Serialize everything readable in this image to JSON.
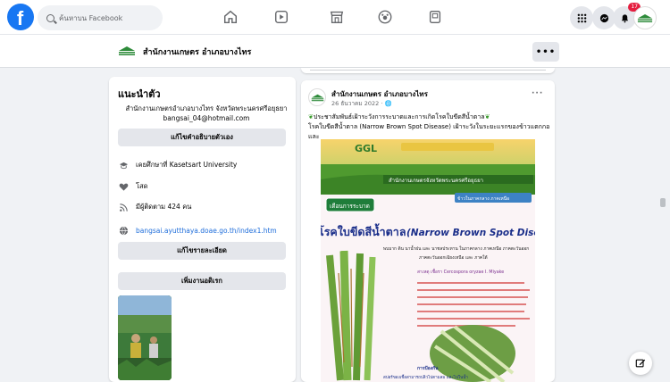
{
  "topbar": {
    "logo_letter": "f",
    "search_placeholder": "ค้นหาบน Facebook",
    "notification_count": "17"
  },
  "page": {
    "name": "สำนักงานเกษตร อำเภอบางไทร",
    "more_label": "•••"
  },
  "intro": {
    "title": "แนะนำตัว",
    "bio_line1": "สำนักงานเกษตรอำเภอบางไทร จังหวัดพระนครศรีอยุธยา",
    "bio_line2": "bangsai_04@hotmail.com",
    "edit_bio_label": "แก้ไขคำอธิบายตัวเอง",
    "studied": "เคยศึกษาที่ Kasetsart University",
    "relationship": "โสด",
    "followers": "มีผู้ติดตาม 424 คน",
    "website": "bangsai.ayutthaya.doae.go.th/index1.htm",
    "edit_details_label": "แก้ไขรายละเอียด",
    "add_hobbies_label": "เพิ่มงานอดิเรก"
  },
  "post": {
    "author": "สำนักงานเกษตร อำเภอบางไทร",
    "date": "26 ธันวาคม 2022 · ",
    "menu": "···",
    "text_line1": "ประชาสัมพันธ์เฝ้าระวังการระบาดและการเกิดโรคใบขีดสีน้ำตาล",
    "text_line2": "โรคใบขีดสีน้ำตาล (Narrow Brown Spot Disease) เฝ้าระวังในระยะแรกของข้าวแตกกอและ",
    "image": {
      "header_text": "สำนักงานเกษตรจังหวัดพระนครศรีอยุธยา",
      "tag_left": "เตือนการระบาด",
      "tag_right": "ข้าวในภาคกลาง ภาคเหนือ",
      "title_th": "โรคใบขีดสีน้ำตาล",
      "title_en": "(Narrow Brown Spot Disease)",
      "subtitle1": "พบมาก ดิน นาน้ำฝน และ นาชลประทาน ในภาคกลาง ภาคเหนือ ภาคตะวันออก",
      "subtitle2": "ภาคตะวันออกเฉียงเหนือ และ ภาคใต้",
      "cause": "สาเหตุ เชื้อรา Cercospora oryzae I. Miyake",
      "bottom_label": "การป้องกัน",
      "bottom_text": "สปอร์ของเชื้อสามารถปลิวไปตามลม และไปในน้ำ"
    }
  },
  "colors": {
    "brand": "#1877f2",
    "badge": "#e41e3f",
    "link": "#216fdb"
  }
}
